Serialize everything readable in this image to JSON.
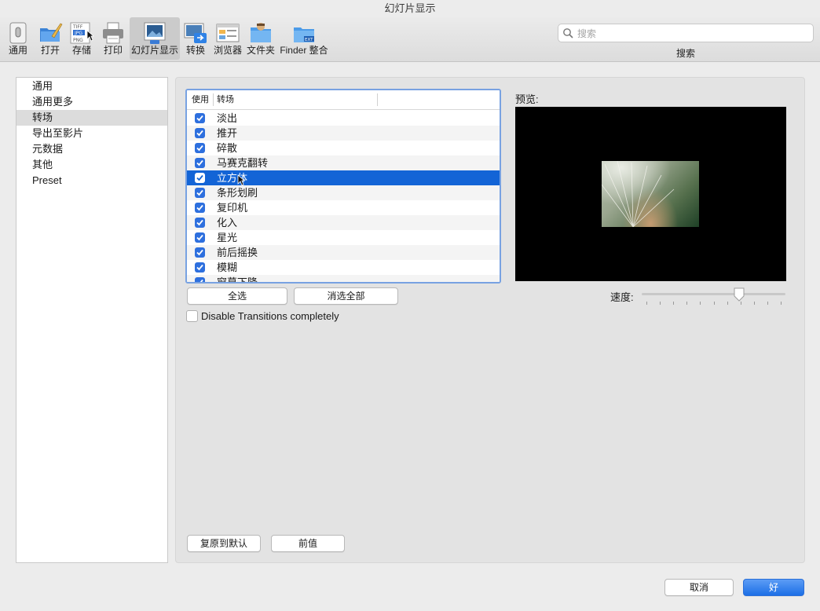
{
  "window": {
    "title": "幻灯片显示"
  },
  "toolbar": {
    "items": [
      {
        "label": "通用",
        "icon": "general-switch-icon"
      },
      {
        "label": "打开",
        "icon": "open-folder-brush-icon"
      },
      {
        "label": "存储",
        "icon": "save-formats-icon"
      },
      {
        "label": "打印",
        "icon": "printer-icon"
      },
      {
        "label": "幻灯片显示",
        "icon": "slideshow-icon",
        "active": true
      },
      {
        "label": "转换",
        "icon": "convert-icon"
      },
      {
        "label": "浏览器",
        "icon": "browser-icon"
      },
      {
        "label": "文件夹",
        "icon": "folder-icon"
      },
      {
        "label": "Finder 整合",
        "icon": "finder-integration-icon"
      }
    ],
    "format_badges": [
      "TIFF",
      "JPG",
      "PNG"
    ],
    "ext_badge": "EXT"
  },
  "search": {
    "placeholder": "搜索",
    "caption": "搜索",
    "value": ""
  },
  "sidebar": {
    "items": [
      {
        "label": "通用"
      },
      {
        "label": "通用更多"
      },
      {
        "label": "转场",
        "selected": true
      },
      {
        "label": "导出至影片"
      },
      {
        "label": "元数据"
      },
      {
        "label": "其他"
      },
      {
        "label": "Preset"
      }
    ]
  },
  "transitions": {
    "headers": {
      "use": "使用",
      "transition": "转场"
    },
    "rows": [
      {
        "name": "淡出",
        "checked": true
      },
      {
        "name": "推开",
        "checked": true
      },
      {
        "name": "碎散",
        "checked": true
      },
      {
        "name": "马赛克翻转",
        "checked": true
      },
      {
        "name": "立方体",
        "checked": true,
        "selected": true
      },
      {
        "name": "条形划刷",
        "checked": true
      },
      {
        "name": "复印机",
        "checked": true
      },
      {
        "name": "化入",
        "checked": true
      },
      {
        "name": "星光",
        "checked": true
      },
      {
        "name": "前后摇换",
        "checked": true
      },
      {
        "name": "模糊",
        "checked": true
      },
      {
        "name": "窗幕下降",
        "checked": true
      }
    ],
    "select_all": "全选",
    "deselect_all": "消选全部",
    "disable_label": "Disable Transitions completely",
    "disable_checked": false
  },
  "preview": {
    "label": "预览:"
  },
  "speed": {
    "label": "速度:",
    "value_fraction": 0.68,
    "tick_count": 11
  },
  "bottom": {
    "restore_defaults": "复原到默认",
    "previous_values": "前值",
    "cancel": "取消",
    "ok": "好"
  },
  "colors": {
    "accent": "#1364d6",
    "checkbox": "#2d6fde",
    "table_focus": "#78a2e2",
    "sidebar_selected": "#dcdcdc"
  }
}
